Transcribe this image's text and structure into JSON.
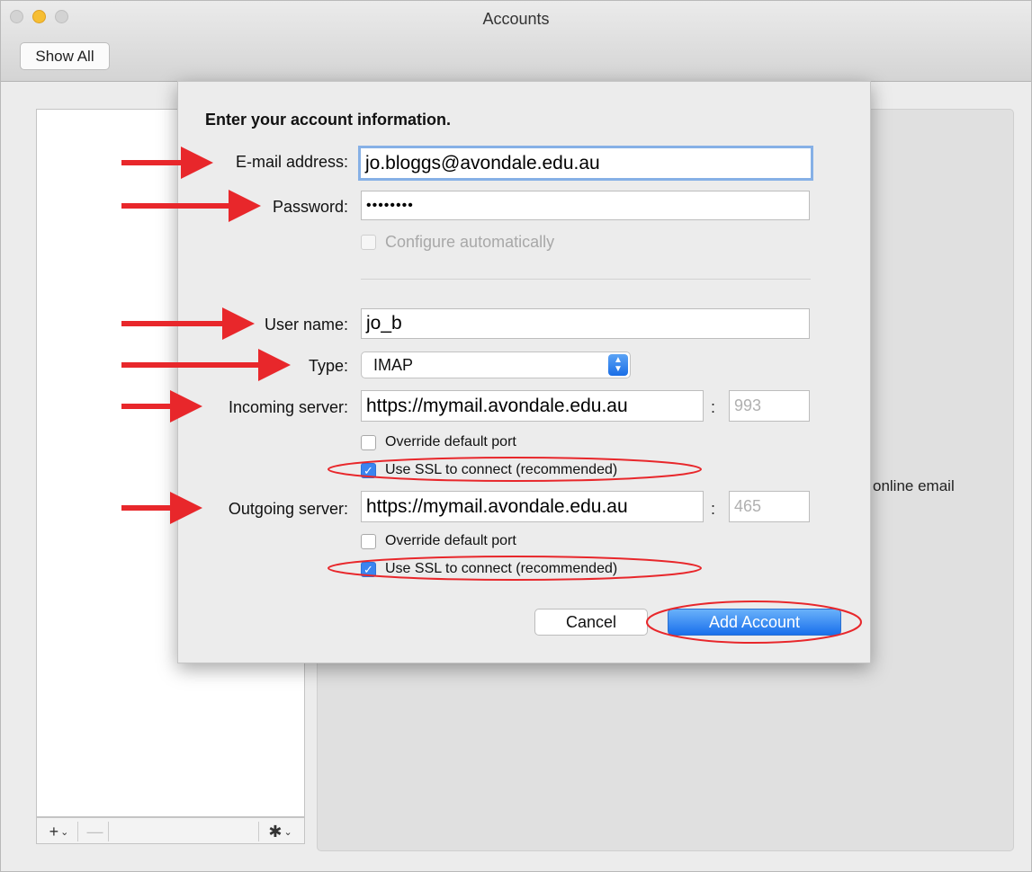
{
  "window": {
    "title": "Accounts",
    "show_all_label": "Show All"
  },
  "sheet": {
    "heading": "Enter your account information.",
    "email": {
      "label": "E-mail address:",
      "value": "jo.bloggs@avondale.edu.au"
    },
    "password": {
      "label": "Password:",
      "value": "••••••••"
    },
    "configure_auto": {
      "label": "Configure automatically",
      "checked": false,
      "enabled": false
    },
    "username": {
      "label": "User name:",
      "value": "jo_b"
    },
    "type": {
      "label": "Type:",
      "value": "IMAP"
    },
    "incoming": {
      "label": "Incoming server:",
      "value": "https://mymail.avondale.edu.au",
      "port": "993",
      "override_label": "Override default port",
      "override_checked": false,
      "ssl_label": "Use SSL to connect (recommended)",
      "ssl_checked": true
    },
    "outgoing": {
      "label": "Outgoing server:",
      "value": "https://mymail.avondale.edu.au",
      "port": "465",
      "override_label": "Override default port",
      "override_checked": false,
      "ssl_label": "Use SSL to connect (recommended)",
      "ssl_checked": true
    },
    "cancel_label": "Cancel",
    "add_account_label": "Add Account"
  },
  "background_pane": {
    "text": "online email"
  },
  "list_toolbar": {
    "add_symbol": "+",
    "remove_symbol": "—",
    "gear_symbol": "✱",
    "caret": "⌄"
  },
  "colors": {
    "accent": "#1a70ec",
    "annotation": "#e8272b"
  },
  "icons": [
    "plus-icon",
    "minus-icon",
    "gear-icon",
    "chevron-down-icon",
    "up-down-arrows-icon",
    "checkmark-icon"
  ]
}
